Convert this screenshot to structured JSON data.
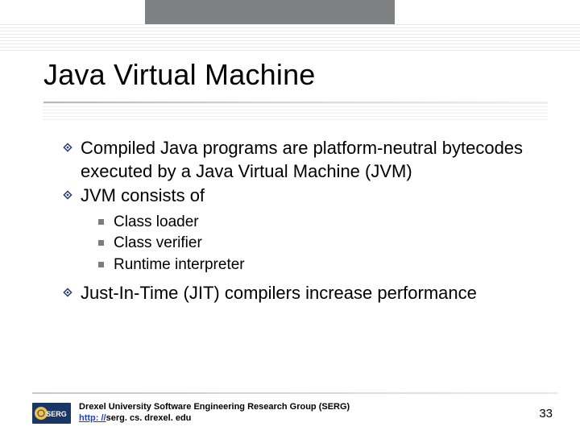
{
  "slide": {
    "title": "Java Virtual Machine",
    "bullets": [
      {
        "text": "Compiled Java programs are platform-neutral bytecodes executed by a Java Virtual Machine (JVM)"
      },
      {
        "text": "JVM consists of",
        "sub": [
          {
            "text": " Class loader"
          },
          {
            "text": "Class verifier"
          },
          {
            "text": "Runtime interpreter"
          }
        ]
      },
      {
        "text": "Just-In-Time (JIT) compilers increase performance"
      }
    ]
  },
  "footer": {
    "org": "Drexel University Software Engineering Research Group (SERG)",
    "link_prefix": "http: //",
    "link_tail": "serg. cs. drexel. edu",
    "page": "33",
    "logo_text": "SERG"
  },
  "colors": {
    "top_bar_gray": "#7f8081",
    "bullet_square": "#7a7c82",
    "link_blue": "#1a3fd4"
  }
}
